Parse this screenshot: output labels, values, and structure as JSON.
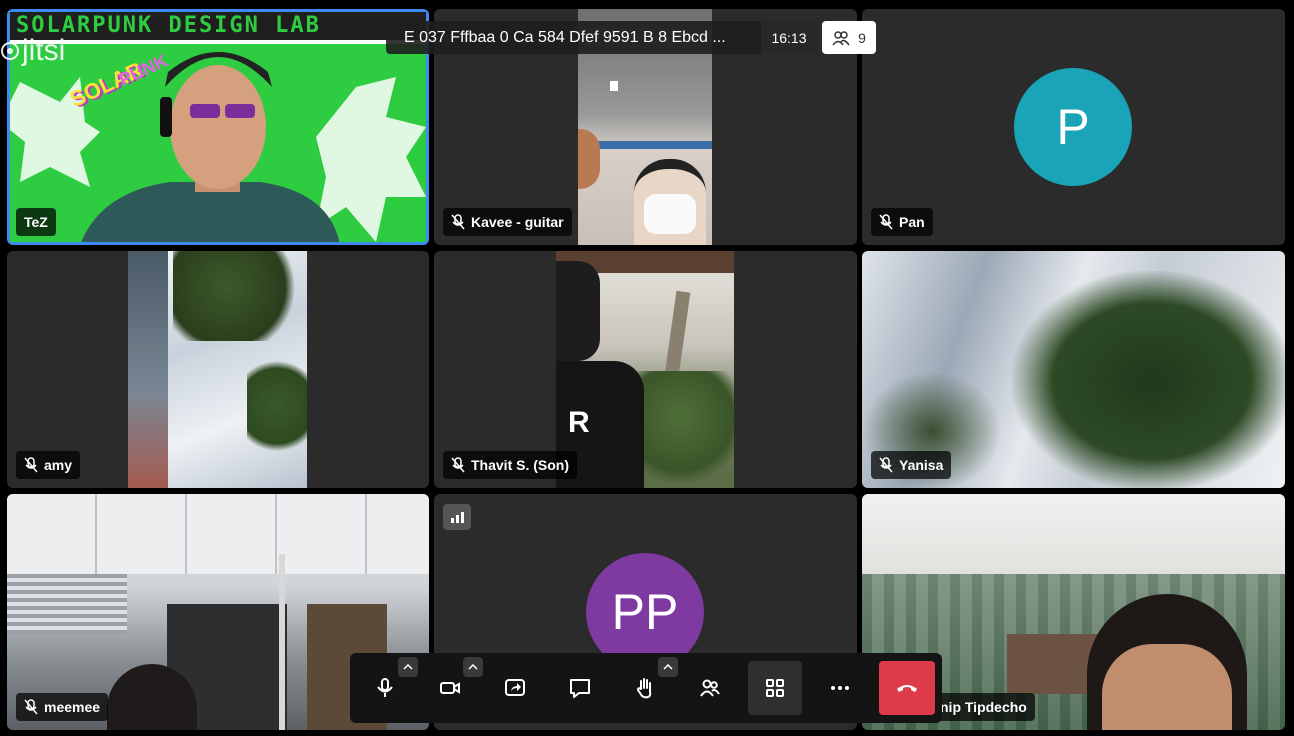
{
  "meeting": {
    "title": "E 037 Fffbaa 0 Ca 584 Dfef 9591 B 8 Ebcd ...",
    "timer": "16:13",
    "participant_count": "9"
  },
  "brand": {
    "logo_text": "jitsi"
  },
  "participants": [
    {
      "name": "TeZ",
      "muted": false,
      "background_text": "SOLARPUNK DESIGN LAB",
      "sticker_top": "SOLAR",
      "sticker_bottom": "PUNK"
    },
    {
      "name": "Kavee - guitar",
      "muted": true
    },
    {
      "name": "Pan",
      "muted": true,
      "avatar_initials": "P",
      "avatar_color": "#1aa4b8"
    },
    {
      "name": "amy",
      "muted": true
    },
    {
      "name": "Thavit S. (Son)",
      "muted": true
    },
    {
      "name": "Yanisa",
      "muted": true
    },
    {
      "name": "meemee",
      "muted": true
    },
    {
      "name": "",
      "muted": false,
      "avatar_initials": "PP",
      "avatar_color": "#7e3aa1"
    },
    {
      "name": "nip Tipdecho",
      "muted": false
    }
  ],
  "toolbar": {
    "buttons": [
      "microphone-icon",
      "camera-icon",
      "share-screen-icon",
      "chat-icon",
      "raise-hand-icon",
      "participants-icon",
      "tile-view-icon",
      "more-icon",
      "hangup-icon"
    ]
  },
  "colors": {
    "accent": "#3d8bef",
    "hangup": "#dd3a4a",
    "tile_bg": "#2b2b2b"
  }
}
